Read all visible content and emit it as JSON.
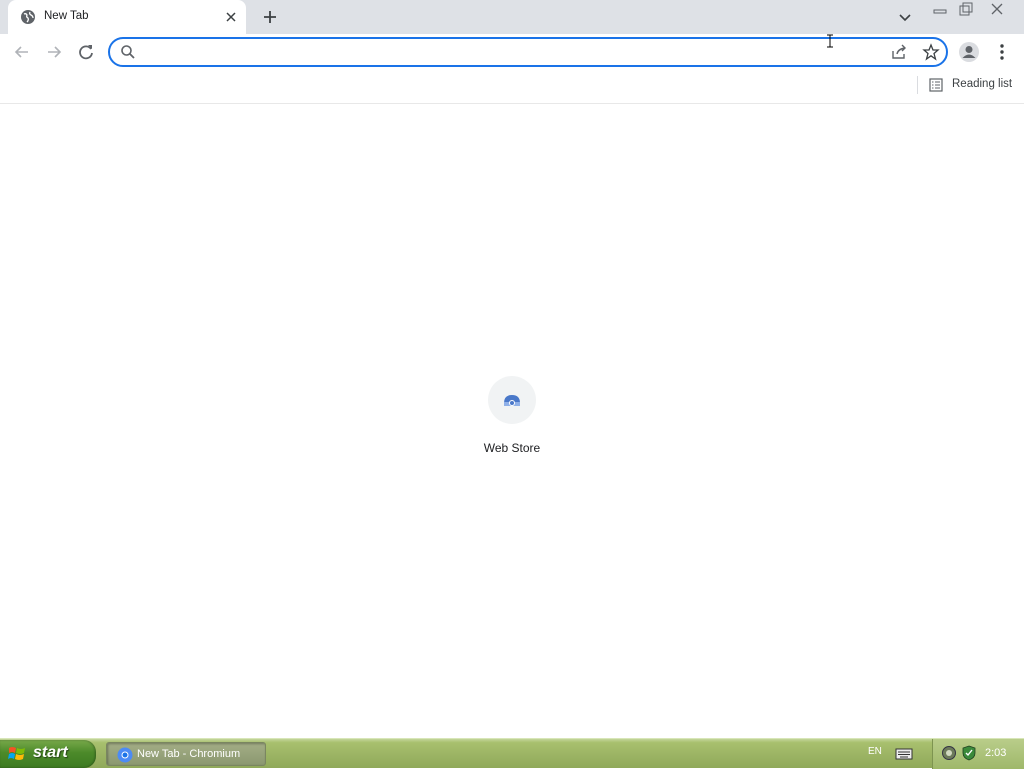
{
  "browser": {
    "tab": {
      "title": "New Tab",
      "favicon": "globe-icon"
    },
    "omnibox": {
      "value": "",
      "placeholder": ""
    },
    "reading_list_label": "Reading list"
  },
  "new_tab_page": {
    "shortcuts": [
      {
        "label": "Web Store",
        "icon": "web-store-icon"
      }
    ]
  },
  "taskbar": {
    "start_label": "start",
    "items": [
      {
        "label": "New Tab - Chromium",
        "icon": "chromium-icon"
      }
    ],
    "language": "EN",
    "clock": "2:03"
  },
  "colors": {
    "accent": "#1a73e8",
    "tabstrip": "#dee1e6",
    "taskbar": "#9db565",
    "start_button": "#4c8a2a"
  }
}
